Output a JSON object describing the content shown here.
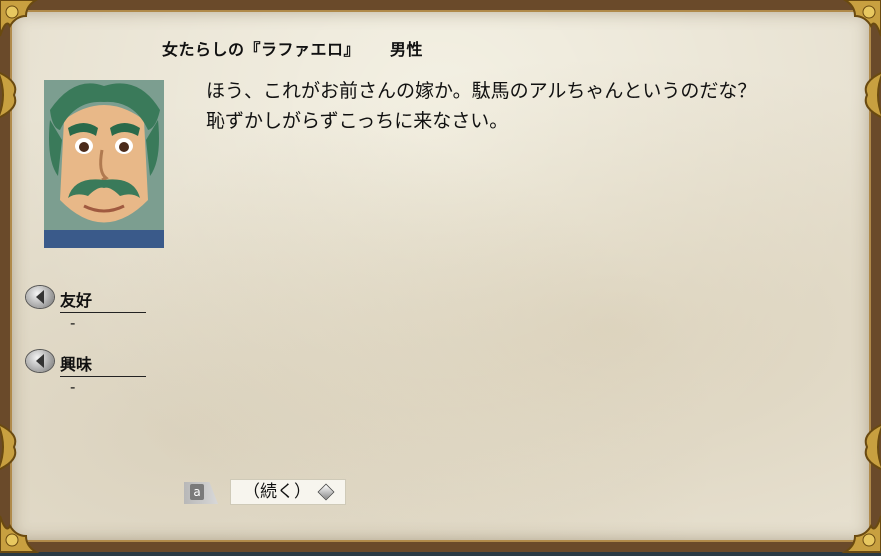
{
  "speaker": {
    "title_name": "女たらしの『ラファエロ』",
    "gender": "男性"
  },
  "dialog": {
    "lines": [
      "ほう、これがお前さんの嫁か。駄馬のアルちゃんというのだな？",
      "恥ずかしがらずこっちに来なさい。"
    ]
  },
  "stats": {
    "friendship": {
      "label": "友好",
      "value": "-"
    },
    "interest": {
      "label": "興味",
      "value": "-"
    }
  },
  "controls": {
    "hotkey": "a",
    "continue_label": "（続く）"
  },
  "colors": {
    "parchment": "#e8e2d2",
    "frame_wood": "#6a4a2a",
    "gold_ornament": "#c8a040"
  },
  "icons": [
    "corner-ornament-icon",
    "side-ornament-icon",
    "stat-arrow-icon",
    "diamond-icon"
  ]
}
